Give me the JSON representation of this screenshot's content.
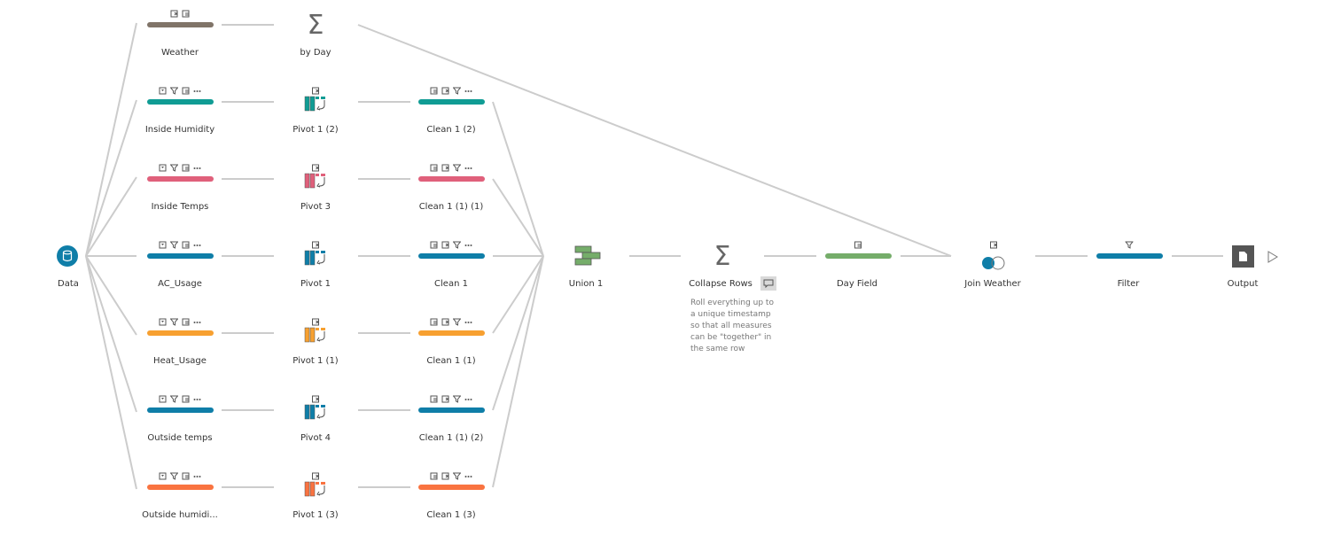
{
  "colors": {
    "brown": "#807468",
    "teal": "#109c94",
    "pink": "#e0607b",
    "blue": "#0f7ea8",
    "orange": "#f7a030",
    "orangered": "#f97340",
    "green": "#75ad6a",
    "line": "#cccccc",
    "output_bg": "#555555"
  },
  "source": {
    "label": "Data",
    "icon": "database-icon"
  },
  "rows": [
    {
      "input": "Weather",
      "input_color": "brown",
      "input_icons": [
        "remove-field-icon",
        "rename-icon"
      ],
      "step2": "by Day",
      "step2_type": "aggregate",
      "clean": null
    },
    {
      "input": "Inside Humidity",
      "input_color": "teal",
      "input_icons": [
        "clean-icon",
        "filter-icon",
        "rename-icon",
        "more-icon"
      ],
      "step2": "Pivot 1 (2)",
      "step2_type": "pivot",
      "clean": "Clean 1 (2)"
    },
    {
      "input": "Inside Temps",
      "input_color": "pink",
      "input_icons": [
        "clean-icon",
        "filter-icon",
        "rename-icon",
        "more-icon"
      ],
      "step2": "Pivot 3",
      "step2_type": "pivot",
      "clean": "Clean 1 (1) (1)"
    },
    {
      "input": "AC_Usage",
      "input_color": "blue",
      "input_icons": [
        "clean-icon",
        "filter-icon",
        "rename-icon",
        "more-icon"
      ],
      "step2": "Pivot 1",
      "step2_type": "pivot",
      "clean": "Clean 1"
    },
    {
      "input": "Heat_Usage",
      "input_color": "orange",
      "input_icons": [
        "clean-icon",
        "filter-icon",
        "rename-icon",
        "more-icon"
      ],
      "step2": "Pivot 1 (1)",
      "step2_type": "pivot",
      "clean": "Clean 1 (1)"
    },
    {
      "input": "Outside temps",
      "input_color": "blue",
      "input_icons": [
        "clean-icon",
        "filter-icon",
        "rename-icon",
        "more-icon"
      ],
      "step2": "Pivot 4",
      "step2_type": "pivot",
      "clean": "Clean 1 (1) (2)"
    },
    {
      "input": "Outside humidi...",
      "input_color": "orangered",
      "input_icons": [
        "clean-icon",
        "filter-icon",
        "rename-icon",
        "more-icon"
      ],
      "step2": "Pivot 1 (3)",
      "step2_type": "pivot",
      "clean": "Clean 1 (3)"
    }
  ],
  "union": {
    "label": "Union 1"
  },
  "collapse": {
    "label": "Collapse Rows",
    "note": [
      "Roll everything up to",
      "a unique timestamp",
      "so that all measures",
      "can be \"together\" in",
      "the same row"
    ]
  },
  "dayfield": {
    "label": "Day Field"
  },
  "join": {
    "label": "Join Weather"
  },
  "filter": {
    "label": "Filter"
  },
  "output": {
    "label": "Output"
  }
}
